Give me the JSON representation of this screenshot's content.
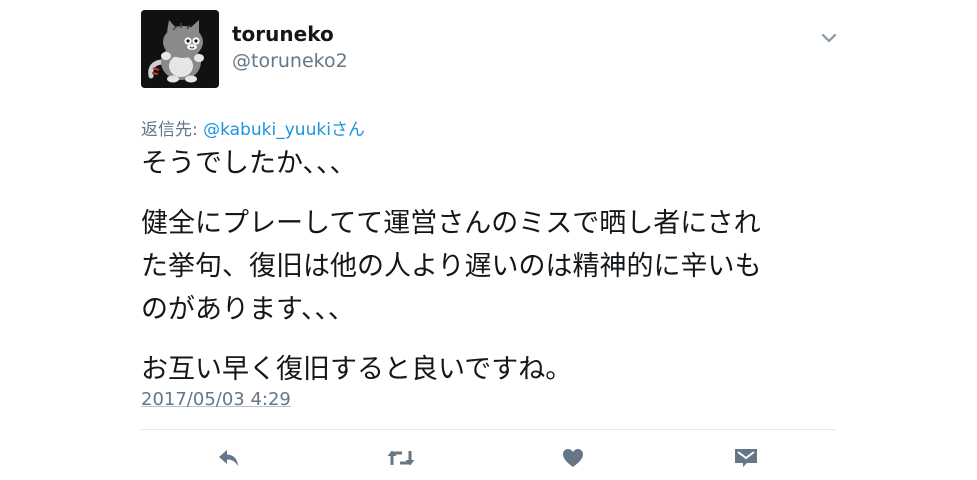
{
  "author": {
    "display_name": "toruneko",
    "handle": "@toruneko2"
  },
  "reply_context": {
    "prefix": "返信先: ",
    "mention": "@kabuki_yuuki",
    "suffix": "さん"
  },
  "tweet": {
    "lines": [
      "そうでしたか、、、",
      "健全にプレーしてて運営さんのミスで晒し者にされ",
      "た挙句、復旧は他の人より遅いのは精神的に辛いも",
      "のがあります、、、",
      "お互い早く復旧すると良いですね。"
    ],
    "timestamp": "2017/05/03 4:29"
  },
  "colors": {
    "text": "#14171a",
    "secondary": "#657786",
    "link": "#1b95e0",
    "divider": "#e1e8ed",
    "icon": "#657786"
  },
  "icons": {
    "avatar": "cat-avatar",
    "caret": "chevron-down-icon",
    "reply": "reply-icon",
    "retweet": "retweet-icon",
    "like": "heart-icon",
    "dm": "envelope-icon"
  }
}
